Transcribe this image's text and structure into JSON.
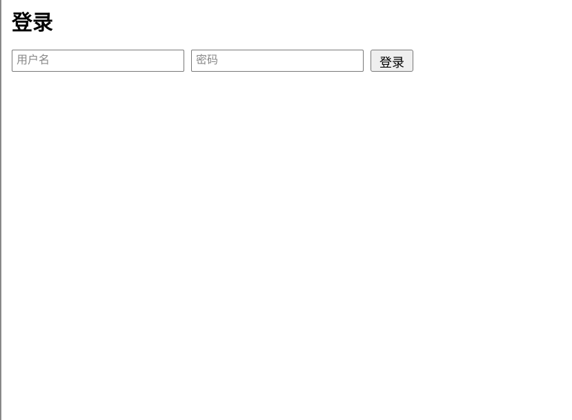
{
  "page": {
    "title": "登录"
  },
  "form": {
    "username": {
      "placeholder": "用户名",
      "value": ""
    },
    "password": {
      "placeholder": "密码",
      "value": ""
    },
    "submit_label": "登录"
  }
}
